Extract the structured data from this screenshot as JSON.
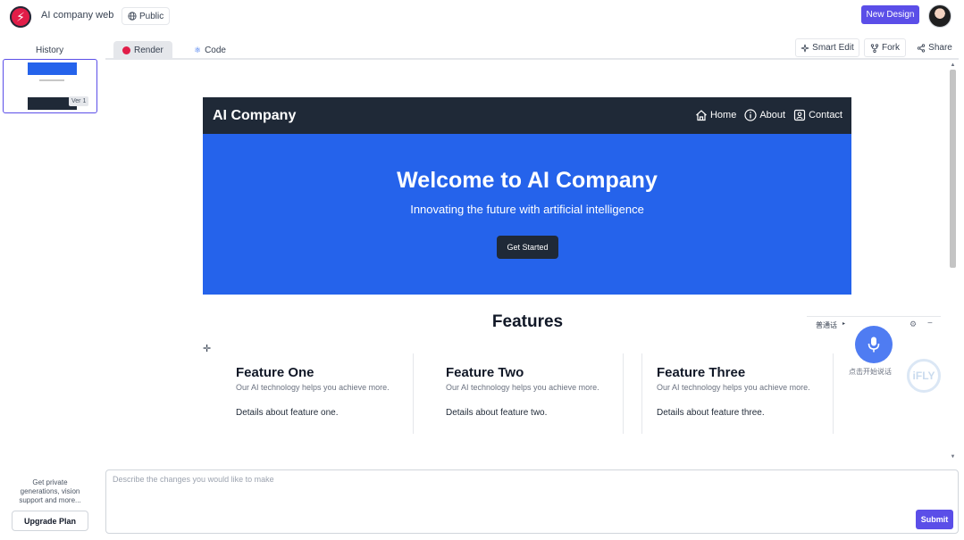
{
  "app": {
    "title": "AI company web",
    "visibility": "Public",
    "new_design_label": "New Design",
    "brand_color": "#5b4ee8"
  },
  "history": {
    "label": "History",
    "items": [
      {
        "version_label": "Ver 1"
      }
    ]
  },
  "tabs": [
    {
      "label": "Render",
      "active": true,
      "icon": "render-icon"
    },
    {
      "label": "Code",
      "active": false,
      "icon": "code-icon"
    }
  ],
  "toolbar": {
    "smart_edit_label": "Smart Edit",
    "fork_label": "Fork",
    "share_label": "Share"
  },
  "preview": {
    "brand": "AI Company",
    "nav_links": [
      {
        "label": "Home",
        "icon": "home-icon"
      },
      {
        "label": "About",
        "icon": "info-icon"
      },
      {
        "label": "Contact",
        "icon": "contact-icon"
      }
    ],
    "hero_title": "Welcome to AI Company",
    "hero_subtitle": "Innovating the future with artificial intelligence",
    "hero_button": "Get Started",
    "hero_color": "#2563eb",
    "nav_color": "#1f2937",
    "features_title": "Features",
    "features": [
      {
        "title": "Feature One",
        "tagline": "Our AI technology helps you achieve more.",
        "detail": "Details about feature one."
      },
      {
        "title": "Feature Two",
        "tagline": "Our AI technology helps you achieve more.",
        "detail": "Details about feature two."
      },
      {
        "title": "Feature Three",
        "tagline": "Our AI technology helps you achieve more.",
        "detail": "Details about feature three."
      }
    ]
  },
  "voice_widget": {
    "label": "普通话",
    "hint": "点击开始说话",
    "brand": "iFLY"
  },
  "upgrade": {
    "text": "Get private generations, vision support and more...",
    "button_label": "Upgrade Plan"
  },
  "prompt": {
    "placeholder": "Describe the changes you would like to make",
    "value": "",
    "submit_label": "Submit"
  }
}
